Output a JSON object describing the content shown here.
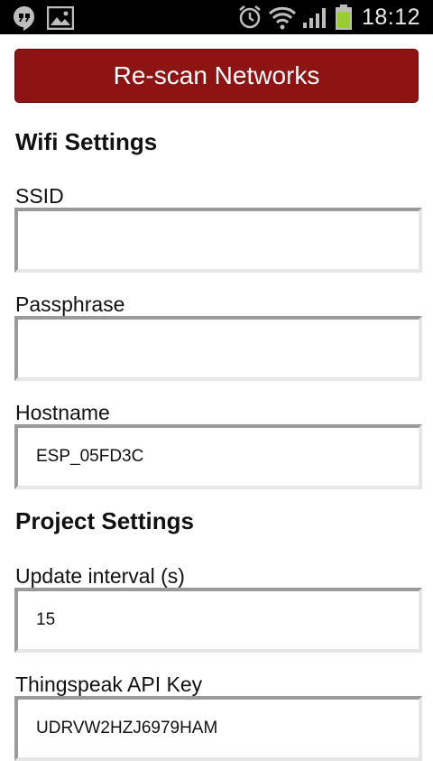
{
  "status_bar": {
    "time": "18:12",
    "icons": [
      "hangouts-icon",
      "gallery-icon",
      "alarm-icon",
      "wifi-icon",
      "signal-icon",
      "battery-charging-icon"
    ]
  },
  "rescan_button": {
    "label": "Re-scan Networks"
  },
  "wifi_settings": {
    "title": "Wifi Settings",
    "ssid": {
      "label": "SSID",
      "value": ""
    },
    "passphrase": {
      "label": "Passphrase",
      "value": ""
    },
    "hostname": {
      "label": "Hostname",
      "value": "ESP_05FD3C"
    }
  },
  "project_settings": {
    "title": "Project Settings",
    "update_interval": {
      "label": "Update interval (s)",
      "value": "15"
    },
    "thingspeak_api_key": {
      "label": "Thingspeak API Key",
      "value": "UDRVW2HZJ6979HAM"
    }
  },
  "colors": {
    "button_bg": "#8e1414",
    "status_bar_bg": "#000000",
    "battery": "#9acd32"
  }
}
